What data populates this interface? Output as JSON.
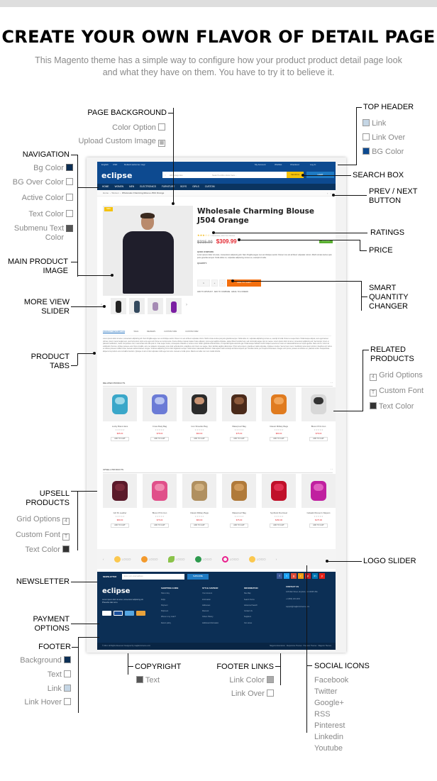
{
  "headline": "CREATE YOUR OWN FLAVOR OF DETAIL PAGE",
  "subline": "This Magento theme has a simple way to configure how your product product detail page look and what they have on them. You have to try it to believe it.",
  "colors": {
    "nav_bg": "#0a3460",
    "top_header_bg": "#0d4a90",
    "footer_bg": "#0c2f55",
    "price": "#e3262f",
    "add_to_cart": "#f46f0e",
    "search_btn": "#f5c20a"
  },
  "annotations": {
    "page_background": {
      "title": "PAGE BACKGROUND",
      "options": [
        "Color Option",
        "Upload Custom Image"
      ]
    },
    "navigation": {
      "title": "NAVIGATION",
      "options": [
        "Bg Color",
        "BG Over Color",
        "Active  Color",
        "Text Color",
        "Submenu Text Color"
      ]
    },
    "top_header": {
      "title": "TOP HEADER",
      "options": [
        "Link",
        "Link Over",
        "BG Color"
      ]
    },
    "search_box": "SEARCH BOX",
    "prev_next": "PREV / NEXT BUTTON",
    "ratings": "RATINGS",
    "price": "PRICE",
    "main_image": "MAIN PRODUCT IMAGE",
    "more_view": "MORE VIEW SLIDER",
    "smart_qty": "SMART QUANTITY CHANGER",
    "product_tabs": "PRODUCT TABS",
    "related": {
      "title": "RELATED PRODUCTS",
      "options": [
        "Grid Options",
        "Custom Font",
        "Text Color"
      ],
      "icons": [
        "4",
        "T",
        ""
      ]
    },
    "upsell": {
      "title": "UPSELL PRODUCTS",
      "options": [
        "Grid Options",
        "Custom Font",
        "Text Color"
      ],
      "icons": [
        "4",
        "T",
        ""
      ]
    },
    "logo_slider": "LOGO SLIDER",
    "newsletter": "NEWSLETTER",
    "payment": "PAYMENT OPTIONS",
    "footer": {
      "title": "FOOTER",
      "options": [
        "Background",
        "Text",
        "Link",
        "Link Hover"
      ]
    },
    "copyright": {
      "title": "COPYRIGHT",
      "options": [
        "Text"
      ]
    },
    "footer_links": {
      "title": "FOOTER LINKS",
      "options": [
        "Link Color",
        "Link Over"
      ]
    },
    "social": {
      "title": "SOCIAL ICONS",
      "items": [
        "Facebook",
        "Twitter",
        "Google+",
        "RSS",
        "Pinterest",
        "Linkedin",
        "Youtube"
      ]
    }
  },
  "mock": {
    "top": {
      "lang": "English",
      "currency": "USD",
      "welcome": "Default welcome msg!",
      "links": [
        "My Account",
        "Wishlist",
        "Checkout",
        "Log In"
      ]
    },
    "logo": "eclipse",
    "search": {
      "category": "All Categories",
      "placeholder": "Search entire store here...",
      "button": "SEARCH",
      "cart": "CART"
    },
    "nav": [
      "HOME",
      "WOMEN",
      "MEN",
      "ELECTRONICS",
      "FURNITURE",
      "BOYS",
      "GIRLS",
      "CUSTOM"
    ],
    "breadcrumb": [
      "Home",
      "Women",
      "Wholesale Charming Blouse J504 Orange"
    ],
    "product": {
      "badge": "NEW",
      "title": "Wholesale Charming Blouse J504 Orange",
      "rating": 3,
      "reviews": "1 Review(s) | Add Your Review",
      "old_price": "$315.00",
      "price": "$309.99",
      "stock": "IN STOCK",
      "overview_label": "QUICK OVERVIEW",
      "overview": "Lorem ipsum dolor sit amet, consectetur adipiscing elit. Nam fringilla augue nec est tristique auctor. Donec non est at libero vulputate rutrum. Morbi ornare lectus quis justo gravida semper. Nulla tellus mi, vulputate adipiscing cursus eu, suscipit id nulla.",
      "qty_label": "QUANTITY:",
      "qty": "1",
      "add_to_cart": "ADD TO CART",
      "links": [
        "ADD TO WISHLIST",
        "ADD TO COMPARE",
        "EMAIL TO A FRIEND"
      ]
    },
    "tabs": [
      "PRODUCT DESCRIPTION",
      "TAGS",
      "REVIEWS",
      "CUSTOM TAB1",
      "CUSTOM TAB2"
    ],
    "description": "Lorem ipsum dolor sit amet, consectetur adipiscing elit. Nam fringilla augue nec est tristique auctor. Donec non est at libero vulputate rutrum. Morbi ornare lectus quis justo gravida semper. Nulla tellus mi, vulputate adipiscing cursus eu, suscipit id nulla. Donec a neque libero. Pellentesque aliquet, sem eget laoreet ultrices, ipsum metus feugiat sem, quis fermentum turpis eros eget velit. Donec ac tempus ante. Fusce ultricies massa massa. Fusce aliquam, purus eget sagittis vulputate, sapien libero hendrerit est, sed commodo augue nisi non neque. Lorem ipsum dolor sit amet, consectetur adipiscing elit. Sed tempor, lorem et placerat vestibulum, metus nisi posuere nisl, in accumsan elit odio quis mi. Cras neque metus, consequat et blandit et, luctus a nunc. Etiam gravida vehicula tellus, in imperdiet ligula euismod eget. Pellentesque habitant morbi tristique senectus et netus et malesuada fames ac turpis egestas. Nam erat mi, rutrum at sollicitudin rhoncus, ultricies posuere erat. Duis convallis, arcu nec aliquam consequat, purus felis vehicula felis, a dapibus enim lorem nec augue. Nunc facilisis sagittis ullamcorper. Proin lectus ipsum, gravida et mattis vulputate, tristique ut lectus. Sed et lorem nunc. Vestibulum ante ipsum primis in faucibus orci luctus et ultrices posuere cubilia Curae; Aenean eleifend laoreet congue. Vivamus adipiscing nisl ut dolor dignissim semper. Nulla luctus malesuada tincidunt. Class aptent taciti sociosqu ad litora torquent per conubia nostra, per inceptos himenaeos. Integer enim purus, posuere at ultricies eu, placerat a felis. Suspendisse aliquet urna pretium eros convallis interdum. Quisque in arcu id dui vulputate mollis eget non arcu. Aenean et nulla purus. Mauris vel tellus non nunc mattis lobortis.",
    "related": {
      "title": "RELATED PRODUCTS",
      "items": [
        {
          "name": "Lucky Brand Jans",
          "price": "$65.00",
          "button": "ADD TO CART"
        },
        {
          "name": "Cross Body Bag",
          "price": "$78.00",
          "button": "ADD TO CART"
        },
        {
          "name": "Icon Shoulder Bag",
          "price": "$90.00",
          "button": "ADD TO CART"
        },
        {
          "name": "Waterproof Bag",
          "price": "$75.00",
          "button": "ADD TO CART"
        },
        {
          "name": "Classic Military Bags",
          "price": "$80.00",
          "button": "ADD TO CART"
        },
        {
          "name": "Bloom Print Icon",
          "price": "$78.00",
          "button": "ADD TO CART"
        }
      ]
    },
    "upsell": {
      "title": "UPSELL PRODUCTS",
      "items": [
        {
          "name": "Girl Pu Leather",
          "price": "$80.00",
          "button": "ADD TO CART"
        },
        {
          "name": "Bloom Print Icon",
          "price": "$75.00",
          "button": "ADD TO CART"
        },
        {
          "name": "Classic Military Bags",
          "price": "$80.00",
          "button": "ADD TO CART"
        },
        {
          "name": "Waterproof Bag",
          "price": "$75.00",
          "button": "ADD TO CART"
        },
        {
          "name": "Synthetic Red Heel",
          "price": "$150.00",
          "button": "ADD TO CART"
        },
        {
          "name": "Catwalk Women's Slippers",
          "price": "$175.00",
          "button": "ADD TO CART"
        }
      ]
    },
    "logos": [
      "LOGO",
      "LOGO",
      "LOGO",
      "LOGO",
      "LOGO",
      "LOGO"
    ],
    "newsletter": {
      "label": "NEWSLETTER",
      "placeholder": "Enter your email address",
      "button": "SUBSCRIBE"
    },
    "footer": {
      "about": "Lorem ipsum dolor sit amet, consectetur adipiscing elit. Phasellus diam arcu.",
      "payments": [
        "PayPal",
        "VISA",
        "AMEX",
        "MasterCard"
      ],
      "columns": [
        {
          "title": "SHOPPING GUIDE",
          "links": [
            "How to buy",
            "FAQs",
            "Payment",
            "Shipment",
            "Where is my order?",
            "Return policy"
          ]
        },
        {
          "title": "STYLE ADVISOR",
          "links": [
            "Your Account",
            "Information",
            "Addresses",
            "Discount",
            "Orders History",
            "Additional Information"
          ]
        },
        {
          "title": "INFORMATION",
          "links": [
            "Site Map",
            "Search Terms",
            "Advanced Search",
            "Contact Us",
            "Suppliers",
            "Our stores"
          ]
        }
      ],
      "contact": {
        "title": "CONTACT US",
        "address": "123 Main Street, Anytown, CA 12345 USA",
        "phone": "+1 (800) 123-1234",
        "email": "support@magikcommerce.com"
      },
      "copyright": "© 2014. All Rights Reserved. Designed by magikcommerce.com",
      "links": [
        "Magento Extensions",
        "Responsive Themes",
        "Premium Themes",
        "Magento Themes"
      ]
    }
  }
}
